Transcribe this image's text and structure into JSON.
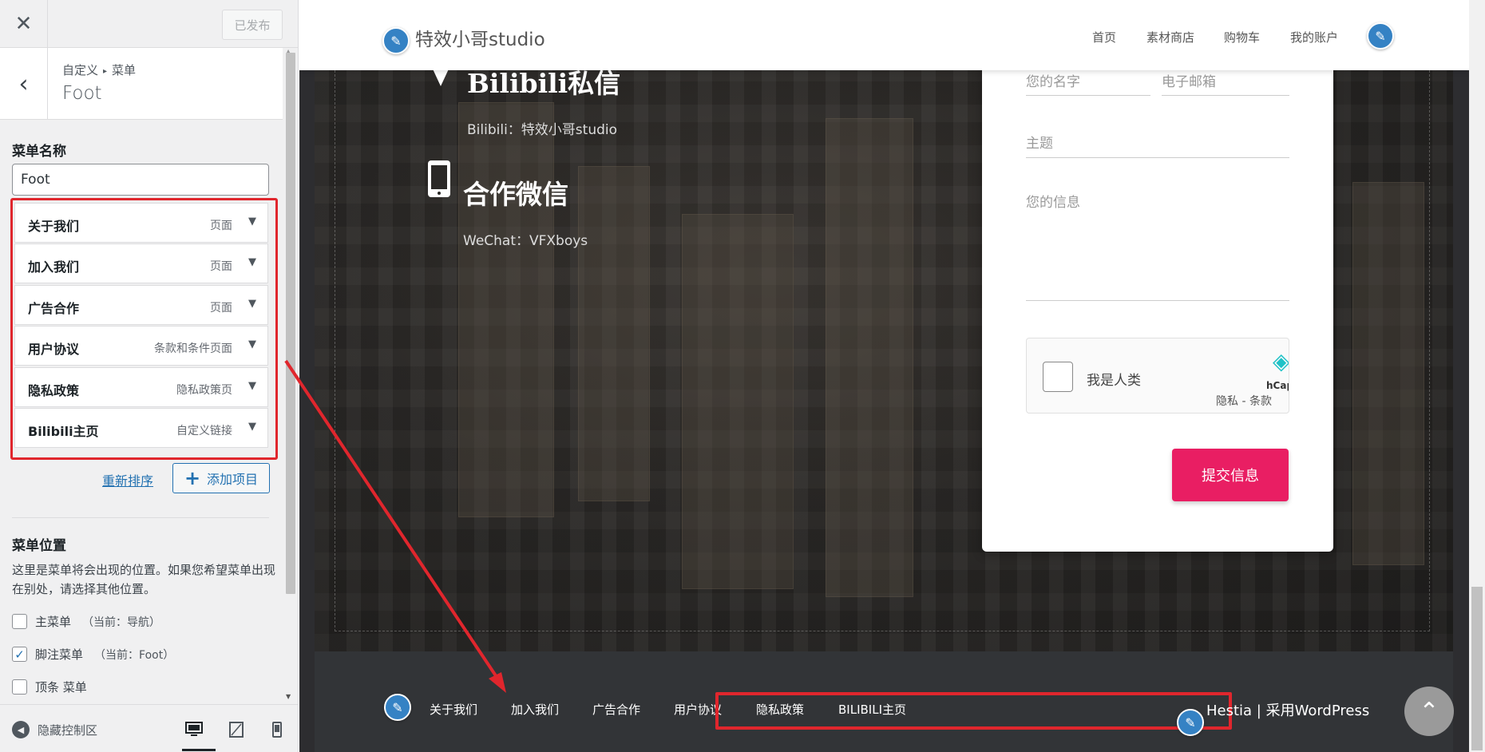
{
  "customizer": {
    "close_glyph": "✕",
    "publish_label": "已发布",
    "back_glyph": "‹",
    "breadcrumb": [
      "自定义",
      "菜单"
    ],
    "breadcrumb_sep": "▸",
    "section_title": "Foot",
    "menu_name_label": "菜单名称",
    "menu_name_value": "Foot",
    "menu_items": [
      {
        "title": "关于我们",
        "type": "页面"
      },
      {
        "title": "加入我们",
        "type": "页面"
      },
      {
        "title": "广告合作",
        "type": "页面"
      },
      {
        "title": "用户协议",
        "type": "条款和条件页面"
      },
      {
        "title": "隐私政策",
        "type": "隐私政策页"
      },
      {
        "title": "Bilibili主页",
        "type": "自定义链接"
      }
    ],
    "reorder_label": "重新排序",
    "add_item_label": "添加项目",
    "location_label": "菜单位置",
    "location_desc": "这里是菜单将会出现的位置。如果您希望菜单出现在别处，请选择其他位置。",
    "locations": [
      {
        "label": "主菜单",
        "current": "（当前：导航）",
        "checked": false
      },
      {
        "label": "脚注菜单",
        "current": "（当前：Foot）",
        "checked": true
      },
      {
        "label": "顶条 菜单",
        "current": "",
        "checked": false
      }
    ],
    "hide_controls_label": "隐藏控制区"
  },
  "preview": {
    "site_title": "特效小哥studio",
    "nav": [
      "首页",
      "素材商店",
      "购物车",
      "我的账户"
    ],
    "contact": {
      "bili_title": "Bilibili私信",
      "bili_sub": "Bilibili：特效小哥studio",
      "wechat_title": "合作微信",
      "wechat_sub": "WeChat：VFXboys"
    },
    "form": {
      "name_placeholder": "您的名字",
      "email_placeholder": "电子邮箱",
      "subject_placeholder": "主题",
      "message_placeholder": "您的信息",
      "captcha_label": "我是人类",
      "captcha_brand": "hCap",
      "captcha_privacy": "隐私 - 条款",
      "submit_label": "提交信息"
    },
    "footer_links": [
      "关于我们",
      "加入我们",
      "广告合作",
      "用户协议",
      "隐私政策",
      "BILIBILI主页"
    ],
    "credit": "Hestia | 采用WordPress"
  },
  "colors": {
    "accent": "#2271b1",
    "submit": "#e91e63",
    "highlight": "#e0262d",
    "edit_pencil": "#3582c4",
    "footer_bg": "#323437"
  },
  "icons": [
    "close-icon",
    "chevron-left-icon",
    "caret-down-icon",
    "plus-icon",
    "checkmark-icon",
    "pencil-icon",
    "location-pin-icon",
    "mobile-phone-icon",
    "hcaptcha-logo-icon",
    "double-chevron-up-icon",
    "desktop-icon",
    "tablet-icon",
    "mobile-icon",
    "arrow-left-circle-icon"
  ]
}
